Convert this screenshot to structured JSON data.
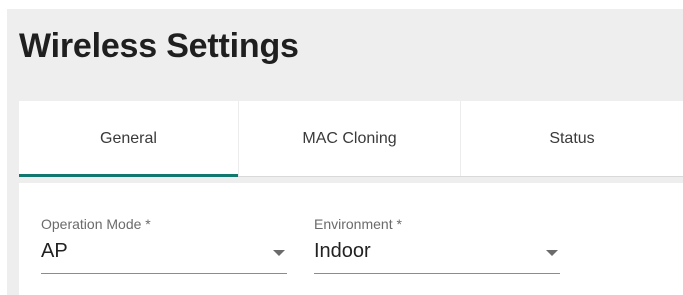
{
  "header": {
    "title": "Wireless Settings"
  },
  "tabs": [
    {
      "label": "General",
      "active": true
    },
    {
      "label": "MAC Cloning",
      "active": false
    },
    {
      "label": "Status",
      "active": false
    }
  ],
  "form": {
    "operation_mode": {
      "label": "Operation Mode *",
      "value": "AP",
      "icon": "chevron-down-icon"
    },
    "environment": {
      "label": "Environment *",
      "value": "Indoor",
      "icon": "chevron-down-icon"
    }
  },
  "colors": {
    "accent": "#12786d",
    "page_background": "#eeeeee",
    "surface": "#ffffff"
  }
}
